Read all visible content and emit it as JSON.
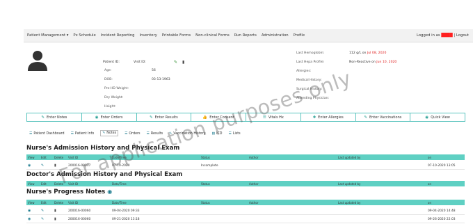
{
  "nav": {
    "items": [
      "Patient Management ▾",
      "Px Schedule",
      "Incident Reporting",
      "Inventory",
      "Printable Forms",
      "Non-clinical Forms",
      "Run Reports",
      "Administration",
      "Profile"
    ],
    "logged_in_prefix": "Logged in as",
    "logged_in_user": "████",
    "logout": "Logout"
  },
  "patient": {
    "patient_id_label": "Patient ID:",
    "visit_id_label": "Visit ID:",
    "age_label": "Age:",
    "age_value": "56",
    "dob_label": "DOB:",
    "dob_value": "03-13-1963",
    "prehd_weight_label": "Pre-HD Weight:",
    "dry_weight_label": "Dry Weight:",
    "height_label": "Height:"
  },
  "clinical": {
    "last_hemoglobin_label": "Last Hemoglobin:",
    "last_hemoglobin_value": "112 g/L on",
    "last_hemoglobin_date": "Jul 08, 2020",
    "last_hepa_label": "Last Hepa Profile:",
    "last_hepa_value": "Non-Reactive on",
    "last_hepa_date": "Jun 10, 2020",
    "allergies_label": "Allergies:",
    "medical_history_label": "Medical History:",
    "surgical_history_label": "Surgical History:",
    "attending_label": "Attending Physician:"
  },
  "action_buttons": [
    {
      "icon": "edit-icon",
      "glyph": "✎",
      "label": "Enter Notes"
    },
    {
      "icon": "orders-icon",
      "glyph": "◉",
      "label": "Enter Orders"
    },
    {
      "icon": "results-icon",
      "glyph": "✎",
      "label": "Enter Results"
    },
    {
      "icon": "consent-icon",
      "glyph": "👍",
      "label": "Enter Consent"
    },
    {
      "icon": "vitals-icon",
      "glyph": "☰",
      "label": "Vitals Hx"
    },
    {
      "icon": "allergy-icon",
      "glyph": "✚",
      "label": "Enter Allergies"
    },
    {
      "icon": "vaccination-icon",
      "glyph": "✎",
      "label": "Enter Vaccinations"
    },
    {
      "icon": "eye-icon",
      "glyph": "◉",
      "label": "Quick View"
    }
  ],
  "tabs": [
    {
      "icon": "dashboard-icon",
      "glyph": "☰",
      "label": "Patient Dashboard"
    },
    {
      "icon": "user-icon",
      "glyph": "☰",
      "label": "Patient Info"
    },
    {
      "icon": "notes-icon",
      "glyph": "✎",
      "label": "Notes"
    },
    {
      "icon": "orders-icon",
      "glyph": "☰",
      "label": "Orders"
    },
    {
      "icon": "results-icon",
      "glyph": "☰",
      "label": "Results"
    },
    {
      "icon": "vaccination-icon",
      "glyph": "✎",
      "label": "Vaccination History"
    },
    {
      "icon": "icd-icon",
      "glyph": "▤",
      "label": "ICD"
    },
    {
      "icon": "lists-icon",
      "glyph": "☰",
      "label": "Lists"
    }
  ],
  "sections": {
    "nurse_admission": "Nurse's Admission History and Physical Exam",
    "doctor_admission": "Doctor's Admission History and Physical Exam",
    "nurse_progress": "Nurse's Progress Notes"
  },
  "table_headers": {
    "view": "View",
    "edit": "Edit",
    "delete": "Delete",
    "visit_id": "Visit ID",
    "datetime": "Date/Time",
    "status": "Status",
    "author": "Author",
    "last_updated_by": "Last updated by",
    "on": "on"
  },
  "nurse_admission_rows": [
    {
      "visit_id": "200016-00037",
      "datetime": "07-10-2020",
      "status": "Incomplete",
      "on": "07-10-2020 13:05"
    }
  ],
  "progress_rows": [
    {
      "visit_id": "200016-00060",
      "datetime": "09-04-2020 09:33",
      "on": "09-04-2020 14:48"
    },
    {
      "visit_id": "200016-00060",
      "datetime": "09-21-2020 13:18",
      "on": "09-26-2020 22:03"
    }
  ],
  "watermark": "For application purposes only",
  "colors": {
    "accent": "#5fd0c3",
    "button_border": "#5ac4be",
    "red": "#e02020"
  }
}
